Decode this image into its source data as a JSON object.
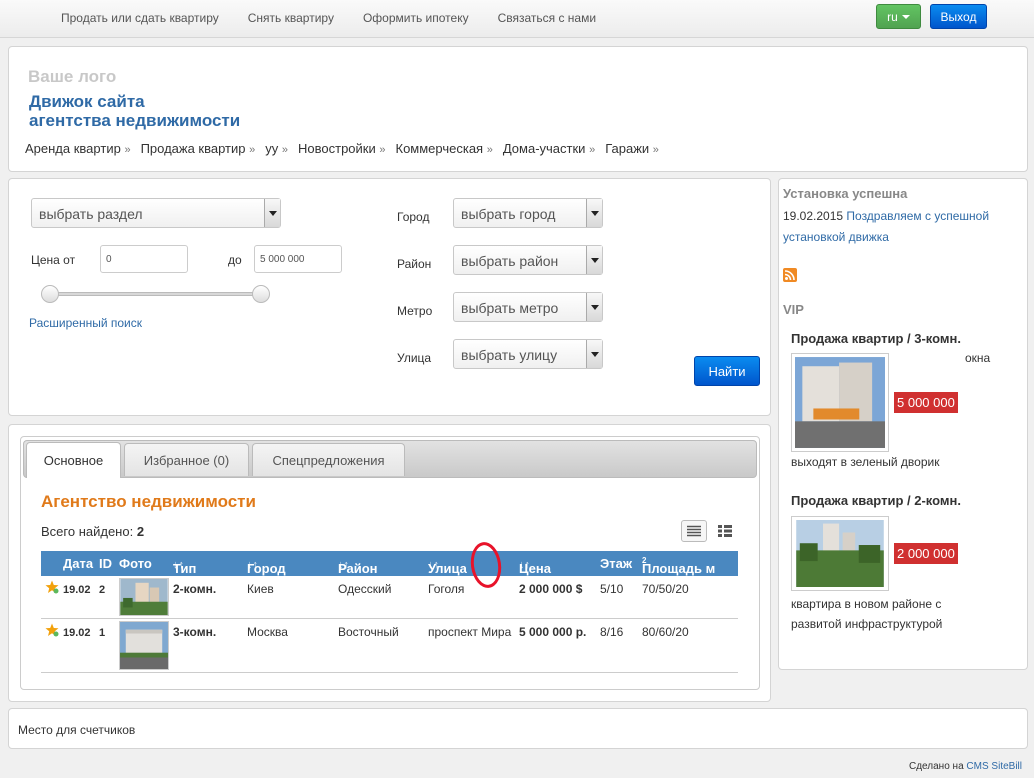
{
  "topnav": {
    "items": [
      "Продать или сдать квартиру",
      "Снять квартиру",
      "Оформить ипотеку",
      "Связаться с нами"
    ],
    "lang_label": "ru",
    "exit_label": "Выход"
  },
  "header": {
    "logo": "Ваше лого",
    "title_line1": "Движок сайта",
    "title_line2": "агентства недвижимости",
    "menu": [
      "Аренда квартир",
      "Продажа квартир",
      "уу",
      "Новостройки",
      "Коммерческая",
      "Дома-участки",
      "Гаражи"
    ],
    "menu_suffix": "»"
  },
  "search": {
    "section_select": "выбрать раздел",
    "price_from_label": "Цена от",
    "price_from_value": "0",
    "price_to_label": "до",
    "price_to_value": "5 000 000",
    "advanced_link": "Расширенный поиск",
    "city_label": "Город",
    "city_select": "выбрать город",
    "district_label": "Район",
    "district_select": "выбрать район",
    "metro_label": "Метро",
    "metro_select": "выбрать метро",
    "street_label": "Улица",
    "street_select": "выбрать улицу",
    "find_label": "Найти",
    "price_slider": {
      "min": 0,
      "max": 5000000,
      "low": 0,
      "high": 5000000
    }
  },
  "results": {
    "tabs": [
      "Основное",
      "Избранное (0)",
      "Спецпредложения"
    ],
    "active_tab": 0,
    "heading": "Агентство недвижимости",
    "found_label": "Всего найдено:",
    "found_count": "2",
    "columns": {
      "date": "Дата",
      "id": "ID",
      "photo": "Фото",
      "type": "Тип",
      "city": "Город",
      "district": "Район",
      "street": "Улица",
      "price": "Цена",
      "floor": "Этаж",
      "area": "Площадь м",
      "area_sup": "2",
      "sort_arrows": "↓↑"
    },
    "rows": [
      {
        "date": "19.02",
        "id": "2",
        "type": "2-комн.",
        "city": "Киев",
        "district": "Одесский",
        "street": "Гоголя",
        "price": "2 000 000 $",
        "floor": "5/10",
        "area": "70/50/20"
      },
      {
        "date": "19.02",
        "id": "1",
        "type": "3-комн.",
        "city": "Москва",
        "district": "Восточный",
        "street": "проспект Мира",
        "price": "5 000 000 р.",
        "floor": "8/16",
        "area": "80/60/20"
      }
    ]
  },
  "sidebar": {
    "news_title": "Установка успешна",
    "news_date": "19.02.2015",
    "news_link_line1": "Поздравляем с успешной",
    "news_link_line2": "установкой движка",
    "vip_title": "VIP",
    "vip": [
      {
        "title": "Продажа квартир / 3-комн.",
        "extra": "окна",
        "price": "5 000 000",
        "desc_line1": "выходят в зеленый дворик",
        "desc_line2": ""
      },
      {
        "title": "Продажа квартир / 2-комн.",
        "extra": "",
        "price": "2 000 000",
        "desc_line1": "квартира в новом районе с",
        "desc_line2": "развитой инфраструктурой"
      }
    ]
  },
  "footer": {
    "counters": "Место для счетчиков",
    "made_prefix": "Сделано на",
    "made_link": "CMS SiteBill"
  },
  "colors": {
    "accent_blue": "#2f6aa6",
    "table_header": "#4a88c0",
    "heading_orange": "#e07a1a",
    "price_red": "#d03030",
    "annotation_red": "#e8132a"
  }
}
